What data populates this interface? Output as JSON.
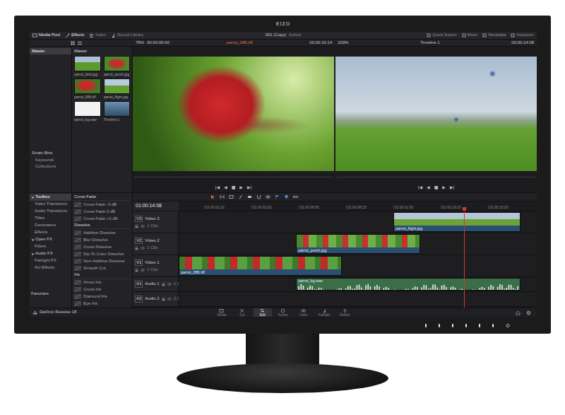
{
  "brand": "EIZO",
  "app_name": "DaVinci Resolve 18",
  "top_tabs": [
    {
      "label": "Media Pool",
      "selected": true
    },
    {
      "label": "Effects",
      "selected": true
    },
    {
      "label": "Index",
      "selected": false
    },
    {
      "label": "Sound Library",
      "selected": false
    }
  ],
  "project": {
    "title": "001 (Copy)",
    "status": "Edited"
  },
  "right_tabs": [
    {
      "label": "Quick Export",
      "selected": false
    },
    {
      "label": "Mixer",
      "selected": false
    },
    {
      "label": "Metadata",
      "selected": false
    },
    {
      "label": "Inspector",
      "selected": false
    }
  ],
  "source_viewer": {
    "zoom": "78%",
    "timecode": "00:00:00:00",
    "clip": "parrot_086.tiff",
    "duration": "00:00:10:14",
    "transport": [
      "|◀",
      "◀",
      "■",
      "▶",
      "▶|"
    ]
  },
  "record_viewer": {
    "zoom": "100%",
    "timeline": "Timeline 1",
    "timecode": "00:00:14:08",
    "transport": [
      "|◀",
      "◀",
      "■",
      "▶",
      "▶|"
    ]
  },
  "media_pool": {
    "bins": [
      {
        "label": "Master",
        "selected": true
      }
    ],
    "smart_bins_title": "Smart Bins",
    "smart_bins": [
      "Keywords",
      "Collections"
    ],
    "header": "Master",
    "clips": [
      {
        "label": "parrot_field.jpg",
        "kind": "image"
      },
      {
        "label": "parrot_perch.jpg",
        "kind": "image"
      },
      {
        "label": "parrot_086.tiff",
        "kind": "image"
      },
      {
        "label": "parrot_flight.jpg",
        "kind": "image"
      },
      {
        "label": "parrot_bg.wav",
        "kind": "audio"
      },
      {
        "label": "Timeline 1",
        "kind": "timeline"
      }
    ]
  },
  "toolbox": {
    "items": [
      {
        "label": "Toolbox",
        "kind": "group",
        "selected": true
      },
      {
        "label": "Video Transitions",
        "kind": "item",
        "selected": false
      },
      {
        "label": "Audio Transitions",
        "kind": "item",
        "selected": false
      },
      {
        "label": "Titles",
        "kind": "item",
        "selected": false
      },
      {
        "label": "Generators",
        "kind": "item",
        "selected": false
      },
      {
        "label": "Effects",
        "kind": "item",
        "selected": false
      },
      {
        "label": "Open FX",
        "kind": "group",
        "selected": false
      },
      {
        "label": "Filters",
        "kind": "item",
        "selected": false
      },
      {
        "label": "Audio FX",
        "kind": "group",
        "selected": false
      },
      {
        "label": "Fairlight FX",
        "kind": "item",
        "selected": false
      },
      {
        "label": "AU Effects",
        "kind": "item",
        "selected": false
      }
    ],
    "footer": "Favorites"
  },
  "effects": [
    {
      "title": "Cross Fade",
      "items": [
        "Cross Fade -3 dB",
        "Cross Fade 0 dB",
        "Cross Fade +3 dB"
      ]
    },
    {
      "title": "Dissolve",
      "items": [
        "Additive Dissolve",
        "Blur Dissolve",
        "Cross Dissolve",
        "Dip To Color Dissolve",
        "Non-Additive Dissolve",
        "Smooth Cut"
      ]
    },
    {
      "title": "Iris",
      "items": [
        "Arrow Iris",
        "Cross Iris",
        "Diamond Iris",
        "Eye Iris"
      ]
    }
  ],
  "timeline": {
    "timecode": "01:00:14:08",
    "span": 18,
    "playhead": 0.796,
    "ruler": [
      "01:00:01:10",
      "01:00:03:20",
      "01:00:06:05",
      "01:00:08:15",
      "01:00:11:00",
      "01:00:13:10",
      "01:00:15:20"
    ],
    "tracks": [
      {
        "id": "V3",
        "name": "Video 3",
        "kind": "video",
        "info": "1 Clip"
      },
      {
        "id": "V2",
        "name": "Video 2",
        "kind": "video",
        "info": "1 Clip"
      },
      {
        "id": "V1",
        "name": "Video 1",
        "kind": "video",
        "info": "1 Clip"
      },
      {
        "id": "A1",
        "name": "Audio 1",
        "kind": "audio",
        "info": "2.0"
      },
      {
        "id": "A2",
        "name": "Audio 2",
        "kind": "audio",
        "info": "2.0"
      }
    ],
    "clips": [
      {
        "track": "V3",
        "label": "parrot_flight.jpg",
        "kind": "video",
        "start": 10.8,
        "length": 6.4
      },
      {
        "track": "V2",
        "label": "parrot_perch.jpg",
        "kind": "video",
        "start": 5.9,
        "length": 6.25
      },
      {
        "track": "V1",
        "label": "parrot_086.tiff",
        "kind": "video",
        "start": 0,
        "length": 8.2
      },
      {
        "track": "A1",
        "label": "parrot_bg.wav",
        "kind": "audio",
        "start": 5.9,
        "length": 11.3
      }
    ]
  },
  "pages": [
    {
      "label": "Media",
      "selected": false
    },
    {
      "label": "Cut",
      "selected": false
    },
    {
      "label": "Edit",
      "selected": true
    },
    {
      "label": "Fusion",
      "selected": false
    },
    {
      "label": "Color",
      "selected": false
    },
    {
      "label": "Fairlight",
      "selected": false
    },
    {
      "label": "Deliver",
      "selected": false
    }
  ]
}
